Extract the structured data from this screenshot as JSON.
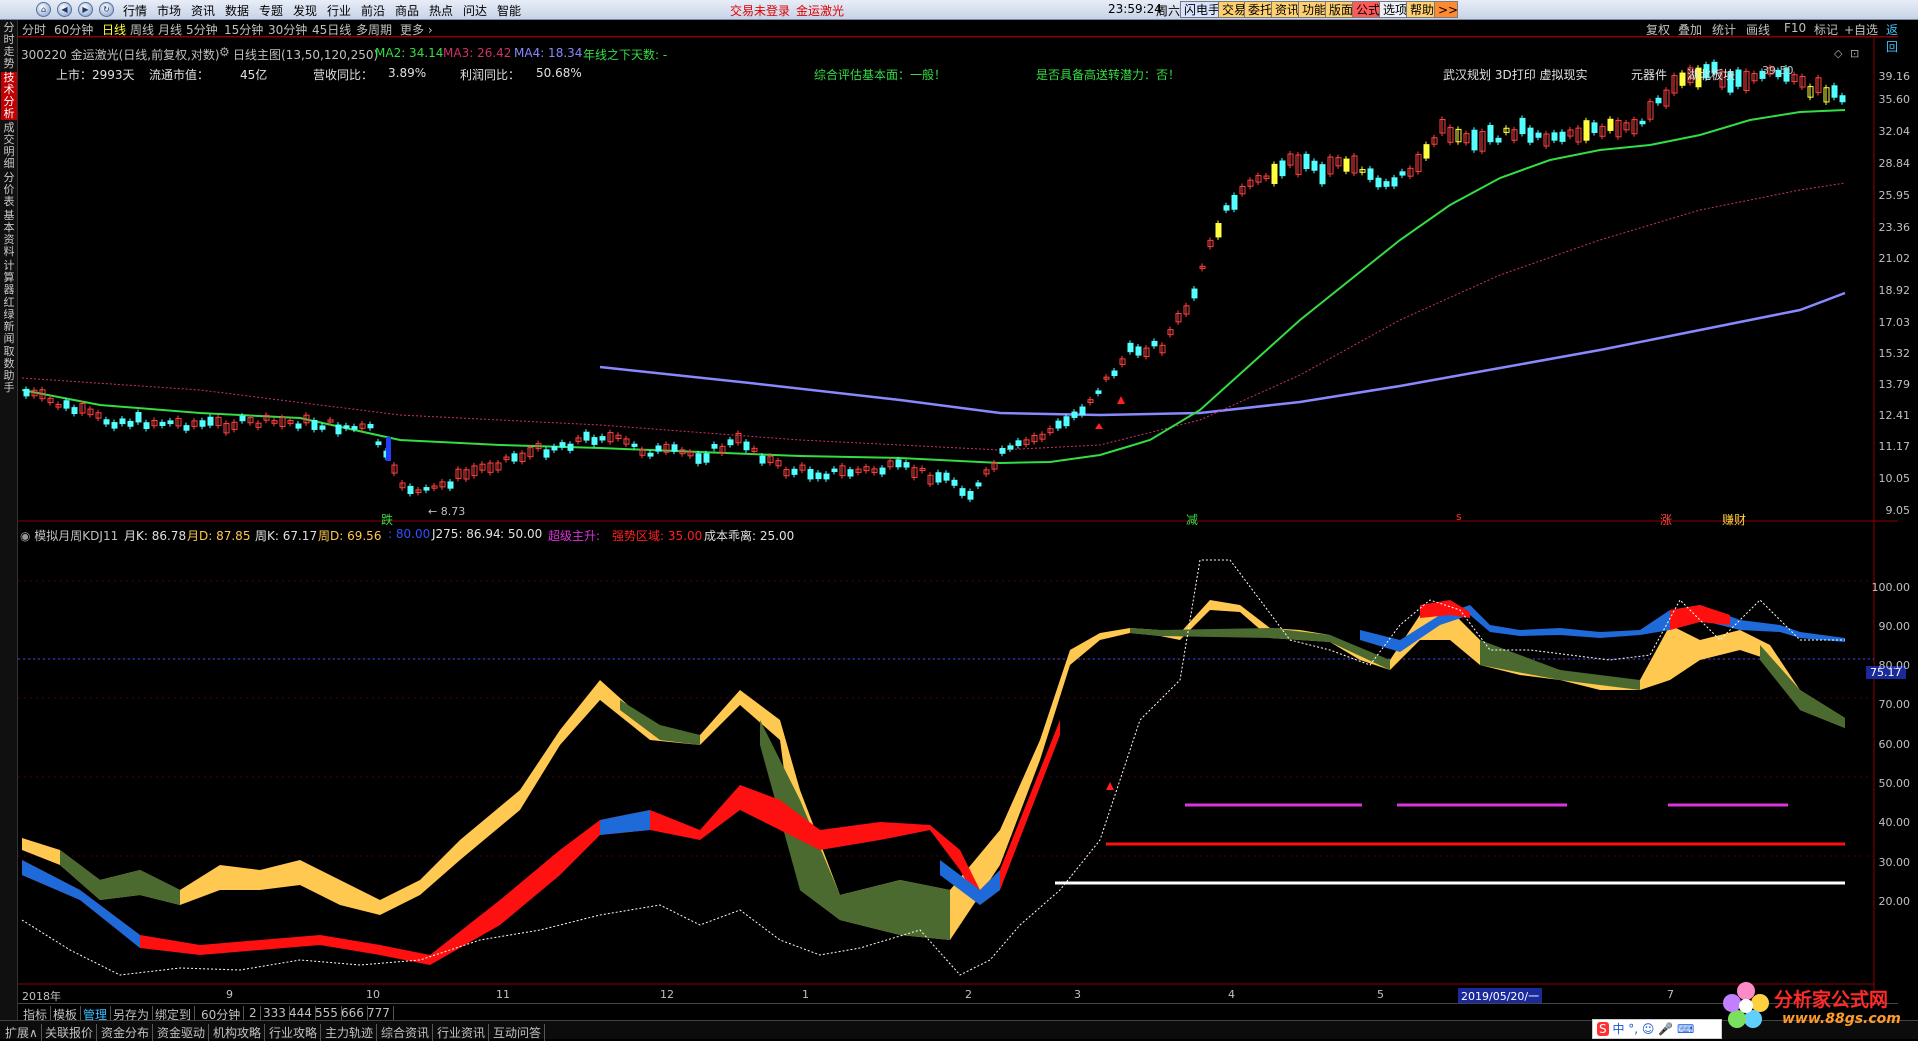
{
  "menubar": {
    "items": [
      "行情",
      "市场",
      "资讯",
      "数据",
      "专题",
      "发现",
      "行业",
      "前沿",
      "商品",
      "热点",
      "问达",
      "智能"
    ],
    "alert1": "交易未登录",
    "alert2": "金运激光",
    "clock": "23:59:24",
    "weekday": "周六",
    "toolbar": [
      "闪电手",
      "交易",
      "委托",
      "资讯",
      "功能",
      "版面",
      "公式",
      "选项",
      "帮助"
    ],
    "more": ">>"
  },
  "leftbar": {
    "tabs": [
      "分时走势",
      "技术分析",
      "成交明细",
      "分价表",
      "基本资料",
      "计算器",
      "红绿新闻",
      "取数助手"
    ]
  },
  "periodbar": {
    "periods": [
      "分时",
      "60分钟",
      "日线",
      "周线",
      "月线",
      "5分钟",
      "15分钟",
      "30分钟",
      "45日线",
      "多周期",
      "更多 ›"
    ],
    "right_tools": [
      "复权",
      "叠加",
      "统计",
      "画线",
      "F10",
      "标记",
      "+自选",
      "返回"
    ]
  },
  "header": {
    "code_name": "300220 金运激光(日线,前复权,对数)",
    "main_label": "日线主图(13,50,120,250)",
    "ma2": "MA2: 34.14",
    "ma3": "MA3: 26.42",
    "ma4": "MA4: 18.34",
    "note": "年线之下天数: -",
    "listed": "上市：2993天",
    "mktcap_label": "流通市值：",
    "mktcap": "45亿",
    "rev_label": "营收同比：",
    "rev": "3.89%",
    "profit_label": "利润同比：",
    "profit": "50.68%",
    "eval": "综合评估基本面：一般！",
    "dividend": "是否具备高送转潜力：否！",
    "tags": "武汉规划 3D打印 虚拟现实",
    "tags2": "元器件",
    "tags3": "湖北板块",
    "hi_label": "39.50",
    "lo_label": "← 8.73"
  },
  "markers": {
    "fall": "跌",
    "reduce": "减",
    "rise": "涨",
    "wealth": "赚财",
    "small_s": "s"
  },
  "indicator": {
    "name": "模拟月周KDJ11",
    "mk": "月K: 86.78",
    "md": "月D: 87.85",
    "wk": "周K: 67.17",
    "wd": "周D: 69.56",
    "v80": ": 80.00",
    "j275": "J275: 86.94",
    "v50": ": 50.00",
    "super": "超级主升: ",
    "strong": "强势区域: 35.00",
    "cost": "成本乖离: 25.00",
    "current": "75.17"
  },
  "price_axis": [
    "39.16",
    "35.60",
    "32.04",
    "28.84",
    "25.95",
    "23.36",
    "21.02",
    "18.92",
    "17.03",
    "15.32",
    "13.79",
    "12.41",
    "11.17",
    "10.05",
    "9.05"
  ],
  "ind_axis": [
    "100.00",
    "90.00",
    "80.00",
    "70.00",
    "60.00",
    "50.00",
    "40.00",
    "30.00",
    "20.00"
  ],
  "time_axis": [
    "2018年",
    "9",
    "10",
    "11",
    "12",
    "1",
    "2",
    "3",
    "4",
    "5",
    "2019/05/20/一",
    "7"
  ],
  "bottom_tabs1": [
    "指标",
    "模板",
    "管理",
    "另存为",
    "绑定到",
    "60分钟",
    "2",
    "333",
    "444",
    "555",
    "666",
    "777"
  ],
  "bottom_tabs2": [
    "扩展∧",
    "关联报价",
    "资金分布",
    "资金驱动",
    "机构攻略",
    "行业攻略",
    "主力轨迹",
    "综合资讯",
    "行业资讯",
    "互动问答"
  ],
  "watermark": {
    "title": "分析家公式网",
    "url": "www.88gs.com"
  },
  "colors": {
    "ma_green": "#33dd44",
    "ma_purple": "#8888ff",
    "ma_pink": "#cc3366",
    "up": "#ff4040",
    "down": "#54ffff",
    "kdj_yellow": "#ffc850",
    "kdj_olive": "#4a6a30",
    "kdj_red": "#ff1010",
    "kdj_blue": "#1e6ad8",
    "magenta": "#dd33dd"
  }
}
